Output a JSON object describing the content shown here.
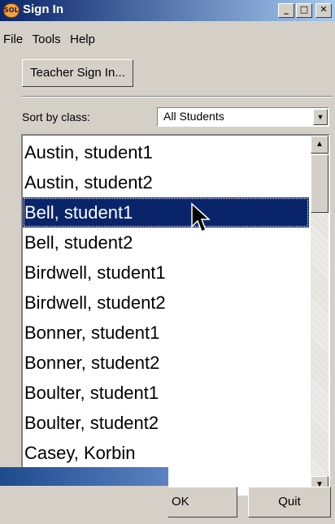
{
  "window": {
    "title": "Sign In",
    "icon": "app-logo-icon"
  },
  "title_buttons": {
    "minimize": "_",
    "maximize": "□",
    "close": "✕"
  },
  "menu": [
    {
      "label": "File"
    },
    {
      "label": "Tools"
    },
    {
      "label": "Help"
    }
  ],
  "teacher_button": "Teacher Sign In...",
  "sort": {
    "label": "Sort by class:",
    "value": "All Students"
  },
  "students": [
    "Austin, student1",
    "Austin, student2",
    "Bell, student1",
    "Bell, student2",
    "Birdwell, student1",
    "Birdwell, student2",
    "Bonner, student1",
    "Bonner, student2",
    "Boulter, student1",
    "Boulter, student2",
    "Casey, Korbin"
  ],
  "selected_index": 2,
  "buttons": {
    "ok": "OK",
    "quit": "Quit"
  },
  "colors": {
    "selection": "#0a246a",
    "title_start": "#0a246a",
    "title_end": "#a6caf0",
    "face": "#d4d0c8"
  }
}
